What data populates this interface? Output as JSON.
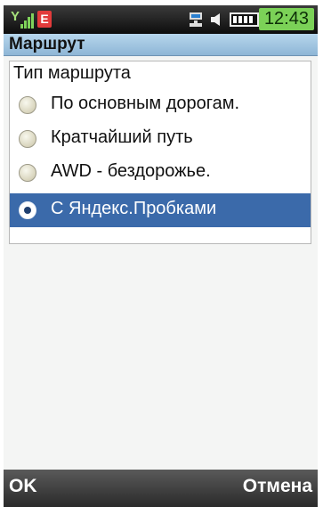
{
  "status": {
    "signal_text": "Y",
    "network_badge": "E",
    "time": "12:43",
    "icons": [
      "signal-icon",
      "network-icon",
      "speaker-icon",
      "battery-icon"
    ]
  },
  "header": {
    "title": "Маршрут"
  },
  "route": {
    "heading": "Тип маршрута",
    "options": [
      {
        "label": "По основным дорогам.",
        "selected": false
      },
      {
        "label": "Кратчайший путь",
        "selected": false
      },
      {
        "label": "AWD - бездорожье.",
        "selected": false
      },
      {
        "label": "С Яндекс.Пробками",
        "selected": true
      }
    ]
  },
  "softkeys": {
    "left": "OK",
    "right": "Отмена"
  },
  "colors": {
    "selection": "#3b6aaa",
    "clock_bg": "#7bd157",
    "title_bar": "#a6c9e3"
  }
}
